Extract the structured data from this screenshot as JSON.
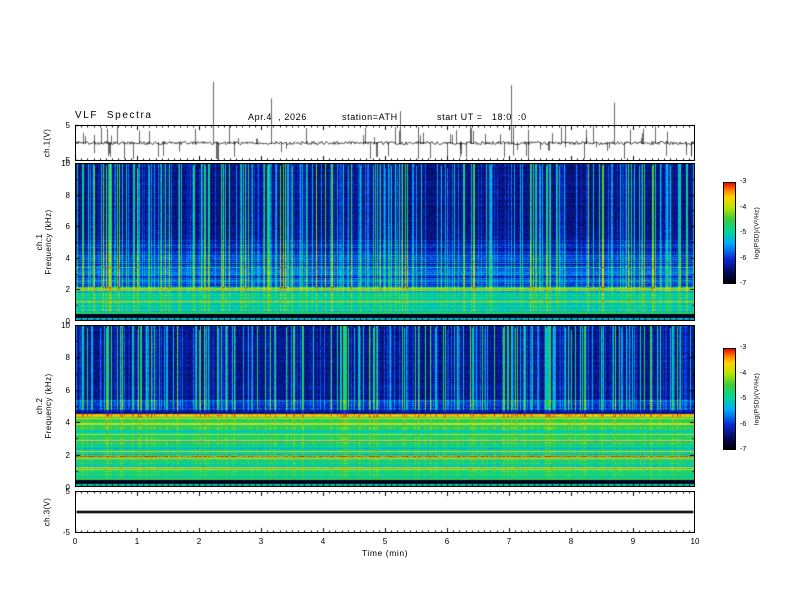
{
  "header": {
    "title": "VLF  Spectra",
    "date": "Apr.4  , 2026",
    "station": "station=ATH",
    "start_ut": "start UT =   18:0  :0"
  },
  "panels": {
    "ch1_wave": {
      "label": "ch.1(V)",
      "ytick_top": "5",
      "ytick_bottom": "-5"
    },
    "ch1_spec": {
      "label_line1": "ch.1",
      "label_line2": "Frequency  (kHz)",
      "yticks": [
        "10",
        "8",
        "6",
        "4",
        "2",
        "0"
      ]
    },
    "ch2_spec": {
      "label_line1": "ch.2",
      "label_line2": "Frequency  (kHz)",
      "yticks": [
        "10",
        "8",
        "6",
        "4",
        "2",
        "0"
      ]
    },
    "ch3_wave": {
      "label": "ch.3(V)",
      "ytick_top": "5",
      "ytick_bottom": "-5"
    }
  },
  "xaxis": {
    "label": "Time  (min)",
    "ticks": [
      "0",
      "1",
      "2",
      "3",
      "4",
      "5",
      "6",
      "7",
      "8",
      "9",
      "10"
    ]
  },
  "colorbars": {
    "label": "log(PSD)/(V²/Hz)",
    "ticks": [
      "-3",
      "-4",
      "-5",
      "-6",
      "-7"
    ]
  },
  "chart_data": [
    {
      "type": "line",
      "title": "ch.1(V) waveform",
      "xlabel": "Time (min)",
      "ylabel": "ch.1(V)",
      "xlim": [
        0,
        10
      ],
      "ylim": [
        -5,
        5
      ],
      "description": "Broadband noise trace centered near 0 V with frequent impulsive sferic spikes; many spikes exceed the ±5 V frame and extend above the panel."
    },
    {
      "type": "heatmap",
      "title": "ch.1 spectrogram",
      "xlabel": "Time (min)",
      "ylabel": "ch.1 Frequency (kHz)",
      "xlim": [
        0,
        10
      ],
      "ylim": [
        0,
        10
      ],
      "zlabel": "log(PSD)/(V²/Hz)",
      "zlim": [
        -7,
        -3
      ],
      "features": [
        "5-10 kHz: dark blue background near -6.5 with dense vertical cyan/green sferic streaks near -5 to -4.5",
        "2-5 kHz: horizontally banded blue/cyan structure around -6 to -5",
        "0.6-2.2 kHz: green/cyan band with yellow horizontal power-line harmonics around -5 to -4",
        "0-0.5 kHz: near-black band at about -7 with one thin green line"
      ]
    },
    {
      "type": "heatmap",
      "title": "ch.2 spectrogram",
      "xlabel": "Time (min)",
      "ylabel": "ch.2 Frequency (kHz)",
      "xlim": [
        0,
        10
      ],
      "ylim": [
        0,
        10
      ],
      "zlabel": "log(PSD)/(V²/Hz)",
      "zlim": [
        -7,
        -3
      ],
      "features": [
        "5.5-10 kHz: dark blue background with dense vertical cyan/green sferic streaks",
        "4.4-4.6 kHz: strong red/orange interference band near -3.5",
        "0.6-4.4 kHz: bright green background with many yellow/orange/red horizontal interference lines, -4.5 to -3",
        "0-0.5 kHz: near-black band at about -7"
      ]
    },
    {
      "type": "line",
      "title": "ch.3(V) waveform",
      "xlabel": "Time (min)",
      "ylabel": "ch.3(V)",
      "xlim": [
        0,
        10
      ],
      "ylim": [
        -5,
        5
      ],
      "description": "Flat thick line at 0 V across the whole record (channel inactive)."
    }
  ]
}
